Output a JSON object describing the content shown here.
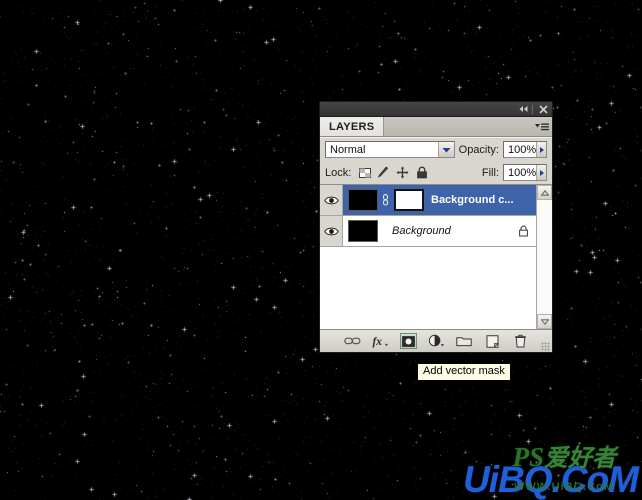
{
  "app": {
    "background_color": "#000000",
    "background_description": "black starfield"
  },
  "panel": {
    "titlebar": {
      "collapse_icon": "double-left-arrows",
      "collapse_glyph": "◂◂",
      "close_icon": "close-x",
      "close_glyph": "✕"
    },
    "tab": {
      "label": "LAYERS",
      "menu_icon": "panel-menu-icon"
    },
    "blend_row": {
      "blend_mode": "Normal",
      "opacity_label": "Opacity:",
      "opacity_value": "100%",
      "dropdown_icon": "chevron-down-icon",
      "spinner_icon": "right-triangle-icon"
    },
    "lock_row": {
      "lock_label": "Lock:",
      "lock_items": [
        {
          "name": "lock-transparent-pixels-icon",
          "title": "Lock transparent pixels"
        },
        {
          "name": "lock-image-pixels-icon",
          "title": "Lock image pixels"
        },
        {
          "name": "lock-position-icon",
          "title": "Lock position"
        },
        {
          "name": "lock-all-icon",
          "title": "Lock all"
        }
      ],
      "fill_label": "Fill:",
      "fill_value": "100%"
    },
    "layers": [
      {
        "name": "Background c...",
        "selected": true,
        "visible": true,
        "has_mask": true,
        "linked": true,
        "locked": false,
        "thumb_color": "#000000",
        "mask_color": "#ffffff"
      },
      {
        "name": "Background",
        "selected": false,
        "visible": true,
        "has_mask": false,
        "linked": false,
        "locked": true,
        "thumb_color": "#000000"
      }
    ],
    "scrollbar": {
      "up_icon": "chevron-up-icon",
      "down_icon": "chevron-down-icon"
    },
    "footer_buttons": [
      {
        "name": "link-layers-button",
        "icon": "chain-link-icon",
        "active": false
      },
      {
        "name": "add-layer-style-button",
        "icon": "fx-icon",
        "active": false
      },
      {
        "name": "add-layer-mask-button",
        "icon": "add-vector-mask-icon",
        "active": true
      },
      {
        "name": "new-fill-adjustment-layer-button",
        "icon": "half-filled-circle-icon",
        "active": false
      },
      {
        "name": "new-group-button",
        "icon": "folder-icon",
        "active": false
      },
      {
        "name": "new-layer-button",
        "icon": "new-page-icon",
        "active": false
      },
      {
        "name": "delete-layer-button",
        "icon": "trash-icon",
        "active": false
      }
    ],
    "resize_grip": "resize-grip"
  },
  "tooltip": {
    "text": "Add vector mask"
  },
  "watermark": {
    "top_text": "PS",
    "top_cjk": "爱好者",
    "main_text": "UiBQ.CoM",
    "sub_text": "WWW.UiBQ.CoM",
    "main_color": "#1f5fd8",
    "accent_color": "#2f7d2f"
  }
}
